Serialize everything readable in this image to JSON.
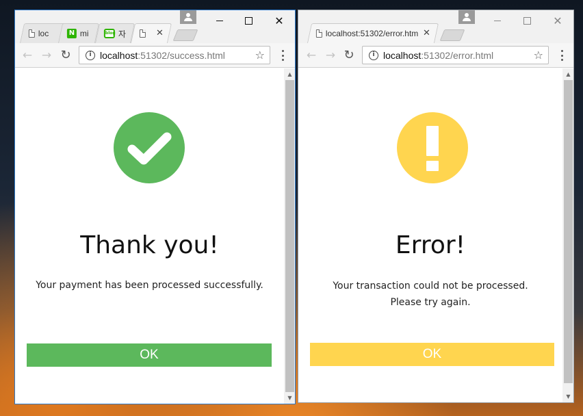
{
  "colors": {
    "success": "#5cb85c",
    "warning": "#ffd54f",
    "window_active_border": "#2b78c9"
  },
  "left_window": {
    "tabs": [
      {
        "label": "loc",
        "icon": "page-icon"
      },
      {
        "label": "mi",
        "icon": "naver-n-icon",
        "icon_text": "N"
      },
      {
        "label": "자",
        "icon": "naver-blog-icon",
        "icon_text": "blog"
      },
      {
        "label": "",
        "icon": "page-icon",
        "active": true
      }
    ],
    "url_host": "localhost",
    "url_path": ":51302/success.html",
    "page": {
      "icon": "check-circle-icon",
      "heading": "Thank you!",
      "message": "Your payment has been processed successfully.",
      "button": "OK"
    }
  },
  "right_window": {
    "tabs": [
      {
        "label": "localhost:51302/error.htm",
        "icon": "page-icon",
        "active": true
      }
    ],
    "url_host": "localhost",
    "url_path": ":51302/error.html",
    "page": {
      "icon": "exclamation-circle-icon",
      "heading": "Error!",
      "message_line1": "Your transaction could not be processed.",
      "message_line2": "Please try again.",
      "button": "OK"
    }
  }
}
